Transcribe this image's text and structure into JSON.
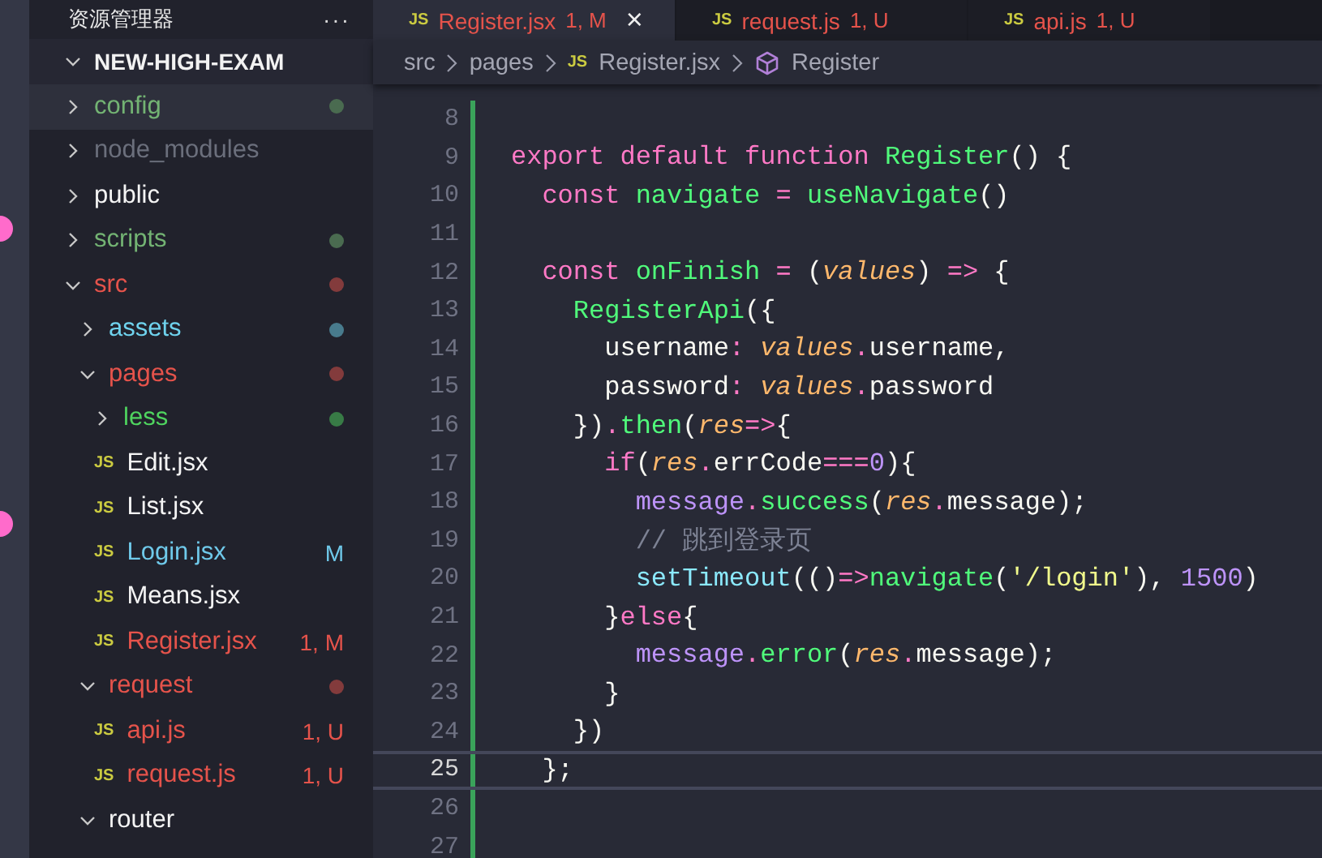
{
  "sidebar": {
    "title": "资源管理器",
    "more": "···",
    "project": {
      "name": "NEW-HIGH-EXAM",
      "expanded": true
    },
    "tree": [
      {
        "kind": "folder",
        "name": "config",
        "expanded": false,
        "selected": true,
        "color": "#73b373",
        "dot": true
      },
      {
        "kind": "folder",
        "name": "node_modules",
        "expanded": false,
        "selected": false,
        "color": "#6b6f7c"
      },
      {
        "kind": "folder",
        "name": "public",
        "expanded": false,
        "selected": false,
        "color": "#f4f4f4"
      },
      {
        "kind": "folder",
        "name": "scripts",
        "expanded": false,
        "selected": false,
        "color": "#73b373",
        "dot": true
      },
      {
        "kind": "folder",
        "name": "src",
        "expanded": true,
        "selected": false,
        "color": "#e5534b",
        "dot": true,
        "children": [
          {
            "kind": "folder",
            "name": "assets",
            "expanded": false,
            "selected": false,
            "color": "#6fd3ee",
            "dot": true
          },
          {
            "kind": "folder",
            "name": "pages",
            "expanded": true,
            "selected": false,
            "color": "#e5534b",
            "dot": true,
            "children": [
              {
                "kind": "folder",
                "name": "less",
                "expanded": false,
                "selected": false,
                "color": "#4fd45f",
                "dot": true
              },
              {
                "kind": "file",
                "icon": "JS",
                "name": "Edit.jsx",
                "selected": false,
                "color": "#f4f4f4"
              },
              {
                "kind": "file",
                "icon": "JS",
                "name": "List.jsx",
                "selected": false,
                "color": "#f4f4f4"
              },
              {
                "kind": "file",
                "icon": "JS",
                "name": "Login.jsx",
                "selected": false,
                "color": "#6fc9ea",
                "badge": "M"
              },
              {
                "kind": "file",
                "icon": "JS",
                "name": "Means.jsx",
                "selected": false,
                "color": "#f4f4f4"
              },
              {
                "kind": "file",
                "icon": "JS",
                "name": "Register.jsx",
                "selected": false,
                "color": "#e5534b",
                "badge": "1, M"
              }
            ]
          },
          {
            "kind": "folder",
            "name": "request",
            "expanded": true,
            "selected": false,
            "color": "#e5534b",
            "dot": true,
            "children": [
              {
                "kind": "file",
                "icon": "JS",
                "name": "api.js",
                "selected": false,
                "color": "#e5534b",
                "badge": "1, U"
              },
              {
                "kind": "file",
                "icon": "JS",
                "name": "request.js",
                "selected": false,
                "color": "#e5534b",
                "badge": "1, U"
              }
            ]
          },
          {
            "kind": "folder",
            "name": "router",
            "expanded": true,
            "selected": false,
            "color": "#f4f4f4"
          }
        ]
      }
    ]
  },
  "tabs": [
    {
      "icon": "JS",
      "label": "Register.jsx",
      "badge": "1, M",
      "selected": true,
      "close": "×"
    },
    {
      "icon": "JS",
      "label": "request.js",
      "badge": "1, U",
      "selected": false
    },
    {
      "icon": "JS",
      "label": "api.js",
      "badge": "1, U",
      "selected": false
    }
  ],
  "breadcrumb": [
    {
      "kind": "folder",
      "label": "src"
    },
    {
      "kind": "folder",
      "label": "pages"
    },
    {
      "kind": "file",
      "icon": "JS",
      "label": "Register.jsx"
    },
    {
      "kind": "symbol",
      "label": "Register"
    }
  ],
  "code": [
    {
      "number": "8",
      "current": false
    },
    {
      "number": "9",
      "current": false,
      "tokens": [
        {
          "kind": "keyword",
          "text": "export default function "
        },
        {
          "kind": "func",
          "text": "Register"
        },
        {
          "kind": "plain",
          "text": "() {"
        }
      ]
    },
    {
      "number": "10",
      "current": false,
      "tokens": [
        {
          "kind": "keyword",
          "text": "  const "
        },
        {
          "kind": "func",
          "text": "navigate"
        },
        {
          "kind": "keyword",
          "text": " = "
        },
        {
          "kind": "func",
          "text": "useNavigate"
        },
        {
          "kind": "plain",
          "text": "()"
        }
      ]
    },
    {
      "number": "11",
      "current": false
    },
    {
      "number": "12",
      "current": false,
      "tokens": [
        {
          "kind": "keyword",
          "text": "  const "
        },
        {
          "kind": "func",
          "text": "onFinish"
        },
        {
          "kind": "keyword",
          "text": " = "
        },
        {
          "kind": "plain",
          "text": "("
        },
        {
          "kind": "param",
          "text": "values"
        },
        {
          "kind": "plain",
          "text": ") "
        },
        {
          "kind": "keyword",
          "text": "=>"
        },
        {
          "kind": "plain",
          "text": " {"
        }
      ]
    },
    {
      "number": "13",
      "current": false,
      "tokens": [
        {
          "kind": "func",
          "text": "    RegisterApi"
        },
        {
          "kind": "plain",
          "text": "({"
        }
      ]
    },
    {
      "number": "14",
      "current": false,
      "tokens": [
        {
          "kind": "plain",
          "text": "      username"
        },
        {
          "kind": "keyword",
          "text": ": "
        },
        {
          "kind": "param",
          "text": "values"
        },
        {
          "kind": "keyword",
          "text": "."
        },
        {
          "kind": "plain",
          "text": "username,"
        }
      ]
    },
    {
      "number": "15",
      "current": false,
      "tokens": [
        {
          "kind": "plain",
          "text": "      password"
        },
        {
          "kind": "keyword",
          "text": ": "
        },
        {
          "kind": "param",
          "text": "values"
        },
        {
          "kind": "keyword",
          "text": "."
        },
        {
          "kind": "plain",
          "text": "password"
        }
      ]
    },
    {
      "number": "16",
      "current": false,
      "tokens": [
        {
          "kind": "plain",
          "text": "    })"
        },
        {
          "kind": "keyword",
          "text": "."
        },
        {
          "kind": "func",
          "text": "then"
        },
        {
          "kind": "plain",
          "text": "("
        },
        {
          "kind": "param",
          "text": "res"
        },
        {
          "kind": "keyword",
          "text": "=>"
        },
        {
          "kind": "plain",
          "text": "{"
        }
      ]
    },
    {
      "number": "17",
      "current": false,
      "tokens": [
        {
          "kind": "keyword",
          "text": "      if"
        },
        {
          "kind": "plain",
          "text": "("
        },
        {
          "kind": "param",
          "text": "res"
        },
        {
          "kind": "keyword",
          "text": "."
        },
        {
          "kind": "plain",
          "text": "errCode"
        },
        {
          "kind": "keyword",
          "text": "==="
        },
        {
          "kind": "number",
          "text": "0"
        },
        {
          "kind": "plain",
          "text": "){"
        }
      ]
    },
    {
      "number": "18",
      "current": false,
      "tokens": [
        {
          "kind": "object",
          "text": "        message"
        },
        {
          "kind": "keyword",
          "text": "."
        },
        {
          "kind": "func",
          "text": "success"
        },
        {
          "kind": "plain",
          "text": "("
        },
        {
          "kind": "param",
          "text": "res"
        },
        {
          "kind": "keyword",
          "text": "."
        },
        {
          "kind": "plain",
          "text": "message);"
        }
      ]
    },
    {
      "number": "19",
      "current": false,
      "tokens": [
        {
          "kind": "comment",
          "text": "        // 跳到登录页"
        }
      ]
    },
    {
      "number": "20",
      "current": false,
      "tokens": [
        {
          "kind": "builtin",
          "text": "        setTimeout"
        },
        {
          "kind": "plain",
          "text": "(()"
        },
        {
          "kind": "keyword",
          "text": "=>"
        },
        {
          "kind": "func",
          "text": "navigate"
        },
        {
          "kind": "plain",
          "text": "("
        },
        {
          "kind": "string",
          "text": "'/login'"
        },
        {
          "kind": "plain",
          "text": "), "
        },
        {
          "kind": "number",
          "text": "1500"
        },
        {
          "kind": "plain",
          "text": ")"
        }
      ]
    },
    {
      "number": "21",
      "current": false,
      "tokens": [
        {
          "kind": "plain",
          "text": "      }"
        },
        {
          "kind": "keyword",
          "text": "else"
        },
        {
          "kind": "plain",
          "text": "{"
        }
      ]
    },
    {
      "number": "22",
      "current": false,
      "tokens": [
        {
          "kind": "object",
          "text": "        message"
        },
        {
          "kind": "keyword",
          "text": "."
        },
        {
          "kind": "func",
          "text": "error"
        },
        {
          "kind": "plain",
          "text": "("
        },
        {
          "kind": "param",
          "text": "res"
        },
        {
          "kind": "keyword",
          "text": "."
        },
        {
          "kind": "plain",
          "text": "message);"
        }
      ]
    },
    {
      "number": "23",
      "current": false,
      "tokens": [
        {
          "kind": "plain",
          "text": "      }"
        }
      ]
    },
    {
      "number": "24",
      "current": false,
      "tokens": [
        {
          "kind": "plain",
          "text": "    })"
        }
      ]
    },
    {
      "number": "25",
      "current": true,
      "tokens": [
        {
          "kind": "plain",
          "text": "  };"
        }
      ]
    },
    {
      "number": "26",
      "current": false
    },
    {
      "number": "27",
      "current": false
    }
  ]
}
